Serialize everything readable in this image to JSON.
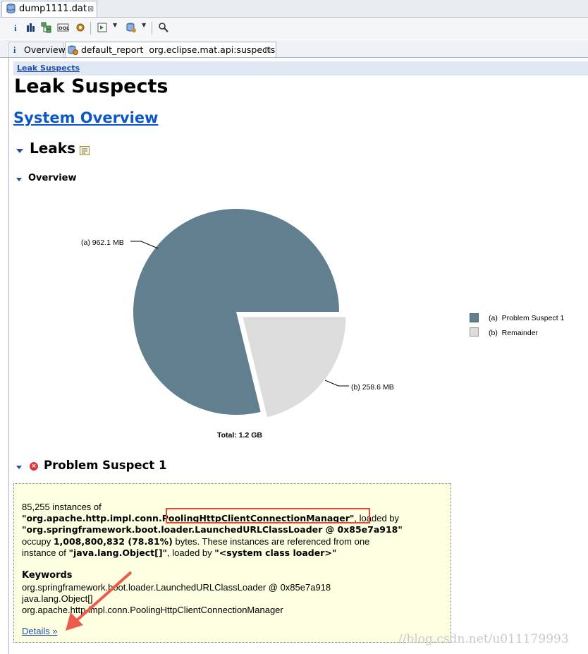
{
  "editor_tab": {
    "label": "dump1111.dat",
    "close": "⊠"
  },
  "report_tabs": {
    "overview": {
      "icon": "i",
      "label": "Overview"
    },
    "report": {
      "label": "default_report  org.eclipse.mat.api:suspects",
      "close": "⊠"
    }
  },
  "breadcrumb": {
    "label": "Leak Suspects"
  },
  "page_title": "Leak Suspects",
  "system_overview_link": "System Overview",
  "leaks_heading": "Leaks",
  "overview_heading": "Overview",
  "chart_data": {
    "type": "pie",
    "slices": [
      {
        "label": "(a)",
        "name": "Problem Suspect 1",
        "value_mb": 962.1,
        "value_text": "962.1 MB",
        "color": "#627f8f"
      },
      {
        "label": "(b)",
        "name": "Remainder",
        "value_mb": 258.6,
        "value_text": "258.6 MB",
        "color": "#dcdcdc",
        "exploded": true
      }
    ],
    "total_label": "Total: 1.2 GB",
    "legend_placement": "right",
    "legend": [
      "(a)  Problem Suspect 1",
      "(b)  Remainder"
    ]
  },
  "problem_suspect": {
    "heading": "Problem Suspect 1",
    "line1": "85,255 instances of",
    "class_prefix": "\"org.apache.http.impl.conn",
    "class_highlight": ".PoolingHttpClientConnectionManager\"",
    "loaded_by_label": ", loaded by",
    "loader": "\"org.springframework.boot.loader.LaunchedURLClassLoader @ 0x85e7a918\"",
    "occupy_prefix": "occupy ",
    "occupy_value": "1,008,800,832 (78.81%)",
    "occupy_suffix": " bytes. These instances are referenced from one",
    "instance_prefix": "instance of ",
    "instance_value": "\"java.lang.Object[]\"",
    "instance_mid": ", loaded by ",
    "instance_loader": "\"<system class loader>\"",
    "keywords_heading": "Keywords",
    "keywords": [
      "org.springframework.boot.loader.LaunchedURLClassLoader @ 0x85e7a918",
      "java.lang.Object[]",
      "org.apache.http.impl.conn.PoolingHttpClientConnectionManager"
    ],
    "details_link": "Details »"
  },
  "watermark": "//blog.csdn.net/u011179993"
}
